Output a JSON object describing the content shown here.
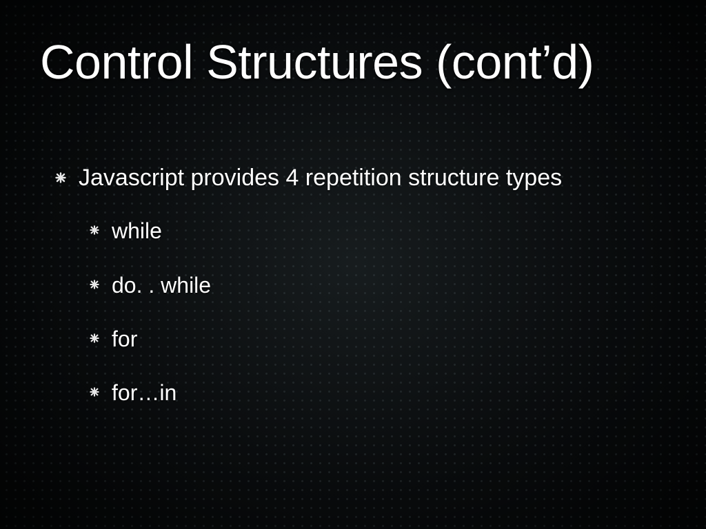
{
  "slide": {
    "title": "Control Structures (cont’d)",
    "bullets": [
      {
        "level": 1,
        "text": "Javascript provides 4 repetition structure types"
      },
      {
        "level": 2,
        "text": "while"
      },
      {
        "level": 2,
        "text": "do. . while"
      },
      {
        "level": 2,
        "text": "for"
      },
      {
        "level": 2,
        "text": "for…in"
      }
    ]
  }
}
